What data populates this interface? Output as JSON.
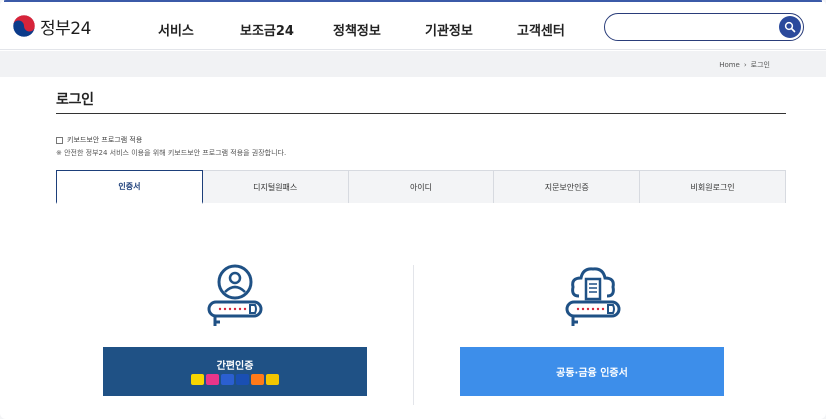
{
  "header": {
    "logo_text": "정부24",
    "nav": [
      "서비스",
      "보조금24",
      "정책정보",
      "기관정보",
      "고객센터"
    ],
    "search_placeholder": ""
  },
  "breadcrumb": {
    "home": "Home",
    "separator": "›",
    "current": "로그인"
  },
  "page": {
    "title": "로그인",
    "keyboard_label": "키보드보안 프로그램 적용",
    "keyboard_note": "※ 안전한 정부24 서비스 이용을 위해 키보드보안 프로그램 적용을 권장합니다."
  },
  "tabs": [
    "인증서",
    "디지털원패스",
    "아이디",
    "지문보안인증",
    "비회원로그인"
  ],
  "active_tab": 0,
  "buttons": {
    "simple_auth": "간편인증",
    "joint_cert": "공동·금융 인증서"
  },
  "simple_auth_badges": [
    {
      "icon": "kakao-icon",
      "color": "#f7d500"
    },
    {
      "icon": "pass-icon",
      "color": "#e9358a"
    },
    {
      "icon": "payco-icon",
      "color": "#2b5fd0"
    },
    {
      "icon": "samsung-pass-icon",
      "color": "#1a4fb3"
    },
    {
      "icon": "toss-icon",
      "color": "#ff7a1a"
    },
    {
      "icon": "naver-icon",
      "color": "#f2c500"
    }
  ],
  "colors": {
    "accent": "#1d3f7a",
    "simple_button": "#1f5185",
    "cert_button": "#3d8eea"
  }
}
